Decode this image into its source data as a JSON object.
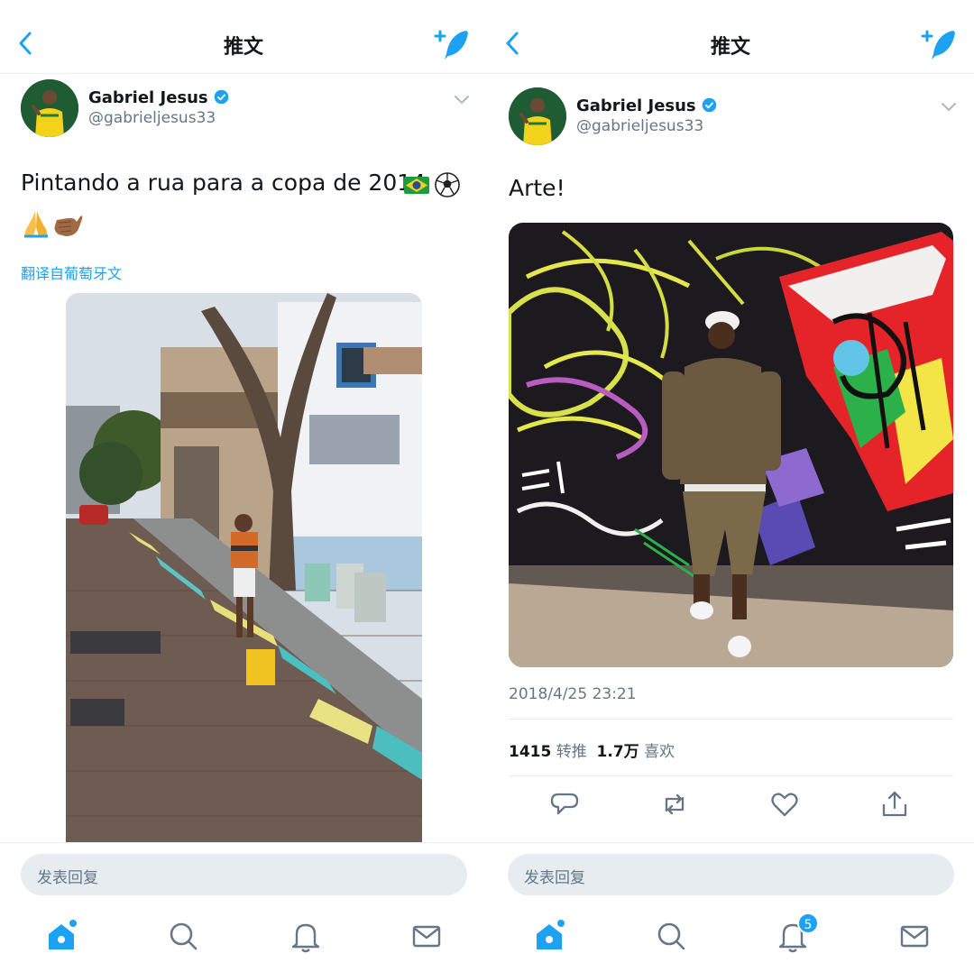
{
  "colors": {
    "accent": "#1da1f2",
    "text": "#14171a",
    "secondary": "#657786",
    "divider": "#e6ecf0"
  },
  "left": {
    "nav_title": "推文",
    "author": {
      "name": "Gabriel Jesus",
      "handle": "@gabrieljesus33",
      "verified": true
    },
    "tweet_text": "Pintando a rua para a copa de 2014",
    "emoji_icons": [
      "brazil-flag-icon",
      "soccer-ball-icon",
      "folded-hands-icon",
      "call-me-hand-icon"
    ],
    "translate_link": "翻译自葡萄牙文",
    "reply_placeholder": "发表回复"
  },
  "right": {
    "nav_title": "推文",
    "author": {
      "name": "Gabriel Jesus",
      "handle": "@gabrieljesus33",
      "verified": true
    },
    "tweet_text": "Arte!",
    "timestamp": "2018/4/25 23:21",
    "stats": {
      "retweets": "1415",
      "retweets_label": "转推",
      "likes": "1.7万",
      "likes_label": "喜欢"
    },
    "reply_placeholder": "发表回复",
    "notification_badge": "5"
  }
}
